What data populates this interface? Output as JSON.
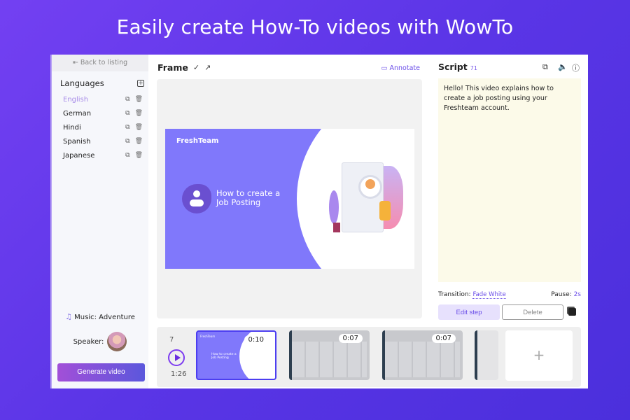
{
  "headline": "Easily create How-To videos with WowTo",
  "sidebar": {
    "back_label": "Back to listing",
    "back_icon": "⇤",
    "languages_title": "Languages",
    "languages": [
      {
        "name": "English",
        "active": true
      },
      {
        "name": "German"
      },
      {
        "name": "Hindi"
      },
      {
        "name": "Spanish"
      },
      {
        "name": "Japanese"
      }
    ],
    "music_label": "Music: Adventure",
    "speaker_label": "Speaker:",
    "generate_label": "Generate video"
  },
  "frame": {
    "title": "Frame",
    "annotate_label": "Annotate",
    "slide": {
      "brand": "FreshTeam",
      "title_line1": "How to create a",
      "title_line2": "Job Posting"
    }
  },
  "script": {
    "title": "Script",
    "count": "71",
    "text": "Hello! This video explains how to create a job posting using your Freshteam account.",
    "transition_label": "Transition:",
    "transition_value": "Fade White",
    "pause_label": "Pause:",
    "pause_value": "2s",
    "edit_label": "Edit step",
    "delete_label": "Delete"
  },
  "timeline": {
    "step_count": "7",
    "total_duration": "1:26",
    "thumbs": [
      {
        "duration": "0:10",
        "brand": "FreshTeam",
        "title": "How to create a Job Posting"
      },
      {
        "duration": "0:07"
      },
      {
        "duration": "0:07"
      },
      {
        "duration": ""
      }
    ],
    "add_label": "+"
  },
  "colors": {
    "accent": "#6a4de8",
    "slide": "#8078fb",
    "script_bg": "#fcfae9"
  }
}
